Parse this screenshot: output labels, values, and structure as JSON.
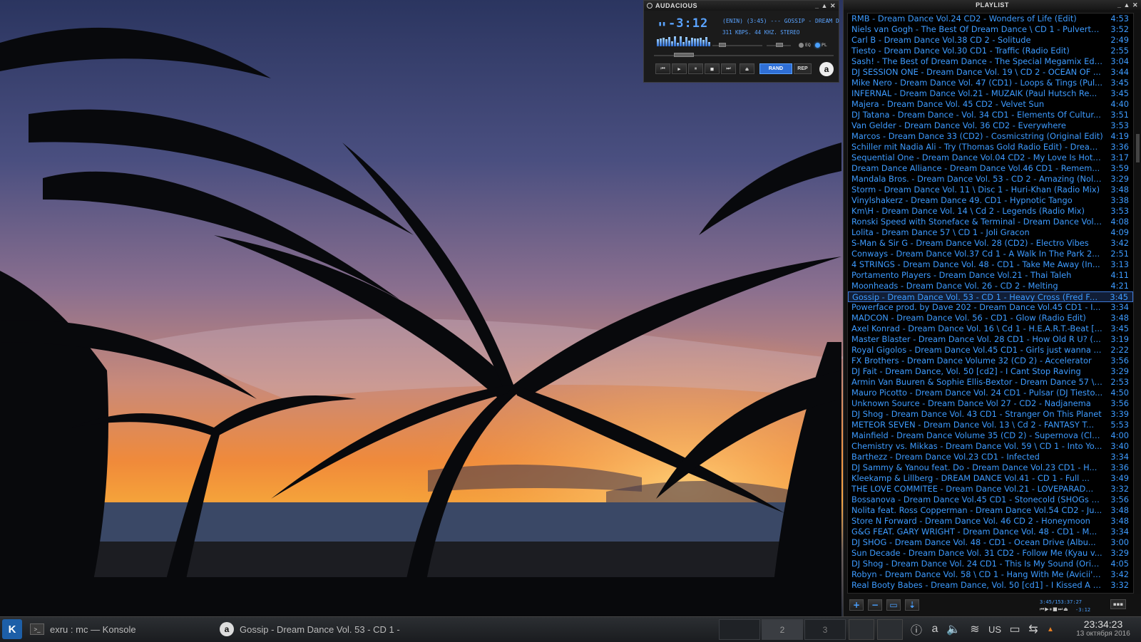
{
  "player": {
    "window_title": "AUDACIOUS",
    "title_controls": [
      "_",
      "▲",
      "✕"
    ],
    "play_indicator": "▮▮",
    "time": "-3:12",
    "ticker": "(ENIN) (3:45) --- GOSSIP - DREAM D",
    "info": "311 KBPS. 44 KHZ. STEREO",
    "eq_label": "EQ",
    "pl_label": "PL",
    "buttons": {
      "prev": "⏮",
      "play": "▶",
      "pause": "⏸",
      "stop": "■",
      "next": "⏭",
      "eject": "⏏",
      "rand": "RAND",
      "rep": "REP",
      "logo": "a"
    },
    "accent_color": "#2f6fd6"
  },
  "playlist": {
    "title": "PLAYLIST",
    "title_controls": [
      "_",
      "▲",
      "✕"
    ],
    "selected_index": 26,
    "items": [
      {
        "title": "RMB - Dream Dance Vol.24  CD2 - Wonders of Life (Edit)",
        "duration": "4:53"
      },
      {
        "title": "Niels van Gogh - The Best Of Dream Dance \\ CD 1 - Pulvertur...",
        "duration": "3:52"
      },
      {
        "title": "Carl B - Dream Dance Vol.38 CD 2 - Solitude",
        "duration": "2:49"
      },
      {
        "title": "Tiesto - Dream Dance Vol.30 CD1 - Traffic (Radio Edit)",
        "duration": "2:55"
      },
      {
        "title": "Sash! - The Best of Dream Dance - The Special Megamix Edi...",
        "duration": "3:04"
      },
      {
        "title": "DJ SESSION ONE - Dream Dance Vol. 19 \\ CD 2 - OCEAN OF ...",
        "duration": "3:44"
      },
      {
        "title": "Mike Nero - Dream Dance Vol. 47 (CD1) - Loops & Tings (Pul...",
        "duration": "3:45"
      },
      {
        "title": "INFERNAL - Dream Dance Vol.21 - MUZAIK (Paul Hutsch Re...",
        "duration": "3:45"
      },
      {
        "title": "Majera - Dream Dance Vol. 45 CD2 - Velvet Sun",
        "duration": "4:40"
      },
      {
        "title": "DJ Tatana - Dream Dance - Vol. 34 CD1 - Elements Of Cultur...",
        "duration": "3:51"
      },
      {
        "title": "Van Gelder - Dream Dance Vol. 36 CD2 - Everywhere",
        "duration": "3:53"
      },
      {
        "title": "Marcos - Dream Dance 33 (CD2) - Cosmicstring (Original Edit)",
        "duration": "4:19"
      },
      {
        "title": "Schiller mit Nadia Ali - Try (Thomas Gold Radio Edit) - Dream...",
        "duration": "3:36"
      },
      {
        "title": "Sequential One - Dream Dance Vol.04 CD2 - My Love Is Hot (...",
        "duration": "3:17"
      },
      {
        "title": "Dream Dance Alliance - Dream Dance Vol.46  CD1 - Remem...",
        "duration": "3:59"
      },
      {
        "title": "Mandala Bros. - Dream Dance Vol. 53 - CD 2 - Amazing (Noli...",
        "duration": "3:29"
      },
      {
        "title": "Storm - Dream Dance Vol. 11 \\ Disc 1 - Huri-Khan (Radio Mix)",
        "duration": "3:48"
      },
      {
        "title": "Vinylshakerz - Dream Dance 49. CD1 - Hypnotic Tango",
        "duration": "3:38"
      },
      {
        "title": "Km\\H - Dream Dance Vol. 14 \\ Cd 2 - Legends (Radio Mix)",
        "duration": "3:53"
      },
      {
        "title": "Ronski Speed with Stoneface & Terminal - Dream Dance Vol....",
        "duration": "4:08"
      },
      {
        "title": "Lolita - Dream Dance 57 \\ CD 1 - Joli Gracon",
        "duration": "4:09"
      },
      {
        "title": " S-Man & Sir G - Dream Dance Vol. 28  (CD2) - Electro Vibes",
        "duration": "3:42"
      },
      {
        "title": "Conways - Dream Dance Vol.37 Cd 1 -  A Walk In The Park 2...",
        "duration": "2:51"
      },
      {
        "title": " 4 STRINGS - Dream Dance Vol. 48 - CD1 - Take Me Away (In...",
        "duration": "3:13"
      },
      {
        "title": "Portamento Players - Dream Dance Vol.21 - Thai Taleh",
        "duration": "4:11"
      },
      {
        "title": "Moonheads - Dream Dance Vol. 26 - CD 2 - Melting",
        "duration": "4:21"
      },
      {
        "title": "Gossip - Dream Dance Vol. 53 - CD 1 - Heavy Cross (Fred Fal...",
        "duration": "3:45"
      },
      {
        "title": "Powerface prod. by Dave 202 - Dream Dance Vol.45 CD1 - I...",
        "duration": "3:34"
      },
      {
        "title": "MADCON - Dream Dance Vol. 56 - CD1 - Glow (Radio Edit)",
        "duration": "3:48"
      },
      {
        "title": "Axel Konrad - Dream Dance Vol. 16 \\ Cd 1 - H.E.A.R.T.-Beat [...",
        "duration": "3:45"
      },
      {
        "title": "Master Blaster - Dream Dance Vol. 28 CD1 - How Old R U? (...",
        "duration": "3:19"
      },
      {
        "title": "Royal Gigolos - Dream Dance Vol.45 CD1 - Girls just wanna ...",
        "duration": "2:22"
      },
      {
        "title": "FX Brothers - Dream Dance Volume 32 (CD 2) - Accelerator",
        "duration": "3:56"
      },
      {
        "title": "DJ Fait - Dream Dance, Vol. 50 [cd2] - I Cant Stop Raving",
        "duration": "3:29"
      },
      {
        "title": "Armin Van Buuren & Sophie Ellis-Bextor - Dream Dance 57 \\ ...",
        "duration": "2:53"
      },
      {
        "title": "Mauro Picotto - Dream Dance Vol. 24 CD1 - Pulsar (DJ Tiesto...",
        "duration": "4:50"
      },
      {
        "title": "Unknown Source - Dream Dance Vol 27 - CD2 - Nadjanema",
        "duration": "3:56"
      },
      {
        "title": "DJ Shog - Dream Dance Vol. 43 CD1 - Stranger On This Planet",
        "duration": "3:39"
      },
      {
        "title": "METEOR SEVEN - Dream Dance Vol. 13 \\ Cd 2 - FANTASY T...",
        "duration": "5:53"
      },
      {
        "title": "Mainfield - Dream Dance Volume 35 (CD 2) - Supernova (Clu...",
        "duration": "4:00"
      },
      {
        "title": "Chemistry vs. Mikkas - Dream Dance Vol. 59 \\ CD 1 - Into Yo...",
        "duration": "3:40"
      },
      {
        "title": " Barthezz - Dream Dance Vol.23 CD1 - Infected",
        "duration": "3:34"
      },
      {
        "title": " DJ Sammy & Yanou feat. Do - Dream Dance Vol.23 CD1 - H...",
        "duration": "3:36"
      },
      {
        "title": "Kleekamp & Lillberg - DREAM DANCE   Vol.41  -  CD 1 - Full ...",
        "duration": "3:49"
      },
      {
        "title": "THE LOVE COMMITEE - Dream Dance Vol.21 - LOVEPARAD...",
        "duration": "3:32"
      },
      {
        "title": "Bossanova - Dream Dance Vol.45 CD1 - Stonecold (SHOGs 2...",
        "duration": "3:56"
      },
      {
        "title": "Nolita feat. Ross Copperman - Dream Dance Vol.54 CD2 - Ju...",
        "duration": "3:48"
      },
      {
        "title": "Store N Forward - Dream Dance Vol. 46 CD 2 - Honeymoon",
        "duration": "3:48"
      },
      {
        "title": " G&G FEAT. GARY WRIGHT - Dream Dance Vol. 48 - CD1 - M...",
        "duration": "3:34"
      },
      {
        "title": " DJ SHOG - Dream Dance Vol. 48 - CD1 - Ocean Drive (Albu...",
        "duration": "3:00"
      },
      {
        "title": "Sun Decade - Dream Dance Vol.  31 CD2 - Follow Me (Kyau v...",
        "duration": "3:29"
      },
      {
        "title": "DJ Shog - Dream Dance Vol. 24 CD1 - This Is My Sound (Origi...",
        "duration": "4:05"
      },
      {
        "title": "Robyn - Dream Dance Vol. 58 \\ CD 1 - Hang With Me (Avicii's...",
        "duration": "3:42"
      },
      {
        "title": "Real Booty Babes - Dream Dance, Vol. 50 [cd1] - I Kissed A G...",
        "duration": "3:32"
      }
    ],
    "bottom": {
      "add": "+",
      "remove": "−",
      "select": "▭",
      "misc": "⇣",
      "total_time": "3:45/153:37:27",
      "mini_controls": "⏮▶⏸■⏭⏏",
      "mini_time": "-3:12",
      "menu": "▪▪▪"
    }
  },
  "taskbar": {
    "kmenu_label": "K",
    "tasks": [
      {
        "icon": "terminal-icon",
        "icon_glyph": ">_",
        "label": "exru : mc — Konsole"
      },
      {
        "icon": "audacious-icon",
        "icon_glyph": "a",
        "label": "Gossip - Dream Dance Vol. 53 - CD 1 -"
      }
    ],
    "desktops": [
      "",
      "2",
      "3"
    ],
    "tray": {
      "info": "ⓘ",
      "audacious": "a",
      "volume": "🔈",
      "wifi": "≋",
      "keyboard_layout": "US",
      "battery": "▭",
      "network": "⇆",
      "arrow": "▲"
    },
    "clock": {
      "time": "23:34:23",
      "date": "13 октября 2016"
    }
  }
}
